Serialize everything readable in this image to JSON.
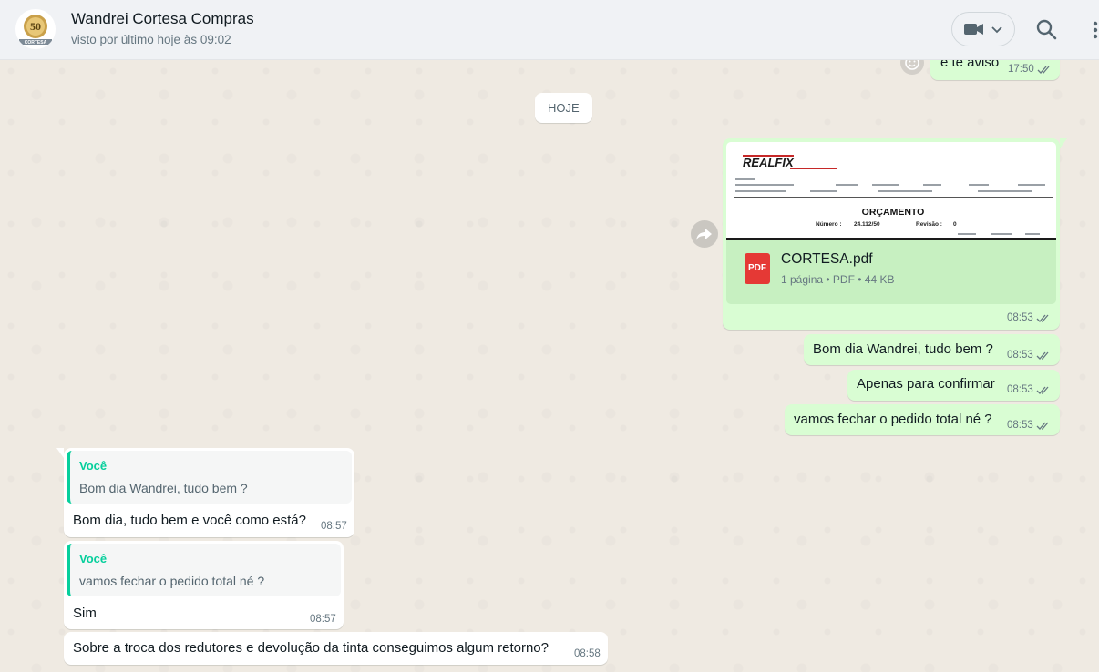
{
  "header": {
    "contact_name": "Wandrei Cortesa Compras",
    "status": "visto por último hoje às 09:02",
    "avatar_badge": "50",
    "avatar_label": "CORTESA",
    "video_icon": "video-camera-icon",
    "search_icon": "search-icon",
    "menu_icon": "kebab-menu-icon"
  },
  "chat": {
    "date_chip": "HOJE",
    "messages": [
      {
        "dir": "out",
        "text": "e te aviso",
        "time": "17:50",
        "status": "read"
      },
      {
        "dir": "out",
        "type": "document",
        "preview": {
          "brand": "REALFIX",
          "title": "ORÇAMENTO",
          "number_label": "Número :",
          "number": "24.112/50",
          "revision_label": "Revisão :",
          "revision": "0"
        },
        "file_name": "CORTESA.pdf",
        "file_info": "1 página • PDF • 44 KB",
        "file_icon": "PDF",
        "time": "08:53",
        "status": "read"
      },
      {
        "dir": "out",
        "text": "Bom dia Wandrei, tudo bem ?",
        "time": "08:53",
        "status": "read"
      },
      {
        "dir": "out",
        "text": "Apenas para confirmar",
        "time": "08:53",
        "status": "read"
      },
      {
        "dir": "out",
        "text": "vamos fechar o pedido total né ?",
        "time": "08:53",
        "status": "read"
      },
      {
        "dir": "in",
        "quote_author": "Você",
        "quote_text": "Bom dia Wandrei, tudo bem ?",
        "text": "Bom dia, tudo bem e você como está?",
        "time": "08:57"
      },
      {
        "dir": "in",
        "quote_author": "Você",
        "quote_text": "vamos fechar o pedido total né ?",
        "text": "Sim",
        "time": "08:57"
      },
      {
        "dir": "in",
        "text": "Sobre a troca dos redutores e devolução da tinta conseguimos algum retorno?",
        "time": "08:58"
      }
    ]
  },
  "colors": {
    "outgoing_bubble": "#d9fdd3",
    "incoming_bubble": "#ffffff",
    "quote_accent": "#06cf9c",
    "read_ticks": "#667781",
    "pdf_red": "#e53935"
  }
}
